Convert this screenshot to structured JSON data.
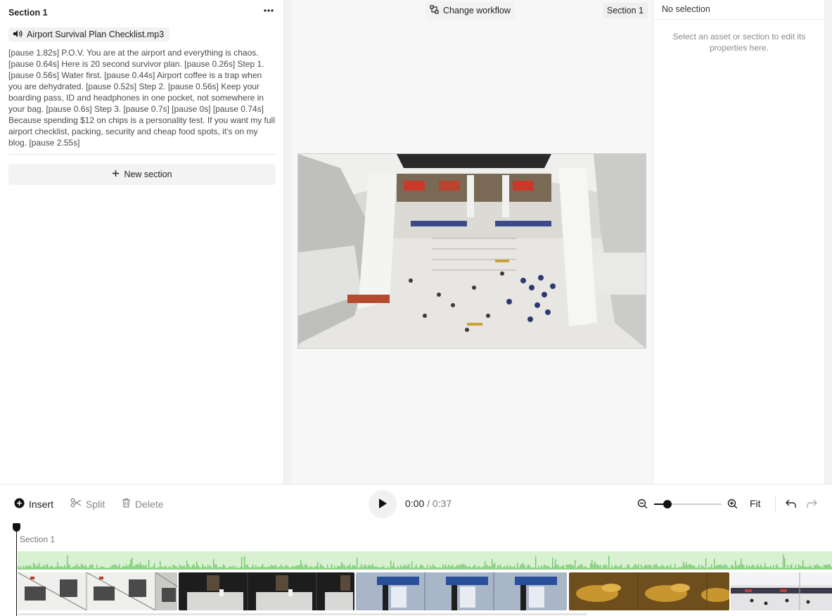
{
  "left_panel": {
    "section_title": "Section 1",
    "audio_file": "Airport Survival Plan Checklist.mp3",
    "script_text": "[pause 1.82s] P.O.V. You are at the airport and everything is chaos. [pause 0.64s] Here is 20 second survivor plan. [pause 0.26s] Step 1. [pause 0.56s] Water first. [pause 0.44s] Airport coffee is a trap when you are dehydrated. [pause 0.52s] Step 2. [pause 0.56s] Keep your boarding pass, ID and headphones in one pocket, not somewhere in your bag. [pause 0.6s] Step 3. [pause 0.7s] [pause 0s] [pause 0.74s] Because spending $12 on chips is a personality test. If you want my full airport checklist, packing, security and cheap food spots, it's on my blog. [pause 2.55s]",
    "new_section_label": "New section"
  },
  "center_panel": {
    "change_workflow_label": "Change workflow",
    "section_tag": "Section 1"
  },
  "right_panel": {
    "title": "No selection",
    "hint": "Select an asset or section to edit its properties here."
  },
  "toolbar": {
    "insert_label": "Insert",
    "split_label": "Split",
    "delete_label": "Delete",
    "time_current": "0:00",
    "time_separator": " / ",
    "time_total": "0:37",
    "zoom_level": 0.2,
    "fit_label": "Fit"
  },
  "timeline": {
    "section_label": "Section 1",
    "clips": [
      "airport-hall",
      "sink-tap",
      "check-in-kiosk",
      "food-closeup",
      "terminal-wide"
    ]
  },
  "colors": {
    "accent": "#111111",
    "waveform_bg": "#d7f1d1",
    "waveform": "#74c76a"
  },
  "icons": [
    "more-icon",
    "speaker-icon",
    "plus-icon",
    "workflow-icon",
    "insert-icon",
    "scissors-icon",
    "trash-icon",
    "play-icon",
    "zoom-out-icon",
    "zoom-in-icon",
    "undo-icon",
    "redo-icon"
  ]
}
